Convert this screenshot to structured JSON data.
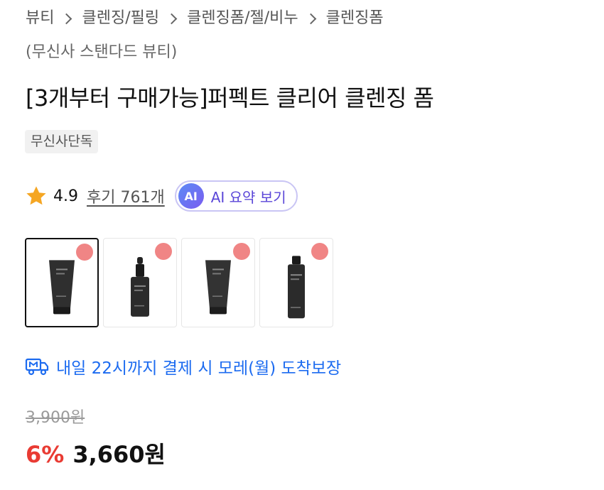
{
  "breadcrumb": {
    "items": [
      "뷰티",
      "클렌징/필링",
      "클렌징폼/젤/비누",
      "클렌징폼"
    ],
    "brand": "(무신사 스탠다드 뷰티)"
  },
  "product": {
    "title": "[3개부터 구매가능]퍼펙트 클리어 클렌징 폼",
    "tag": "무신사단독"
  },
  "rating": {
    "score": "4.9",
    "review_link": "후기 761개",
    "icon": "star-icon",
    "star_color": "#f5a623"
  },
  "ai_summary": {
    "badge": "AI",
    "label": "AI 요약 보기"
  },
  "thumbnails": [
    {
      "product": "tube",
      "selected": true
    },
    {
      "product": "dropper-bottle",
      "selected": false
    },
    {
      "product": "tube",
      "selected": false
    },
    {
      "product": "tall-bottle",
      "selected": false
    }
  ],
  "delivery": {
    "icon": "truck-icon",
    "text": "내일 22시까지 결제 시 모레(월) 도착보장",
    "color": "#1c6bf0"
  },
  "price": {
    "original": "3,900원",
    "discount": "6%",
    "sale": "3,660원",
    "discount_color": "#e93b33"
  }
}
